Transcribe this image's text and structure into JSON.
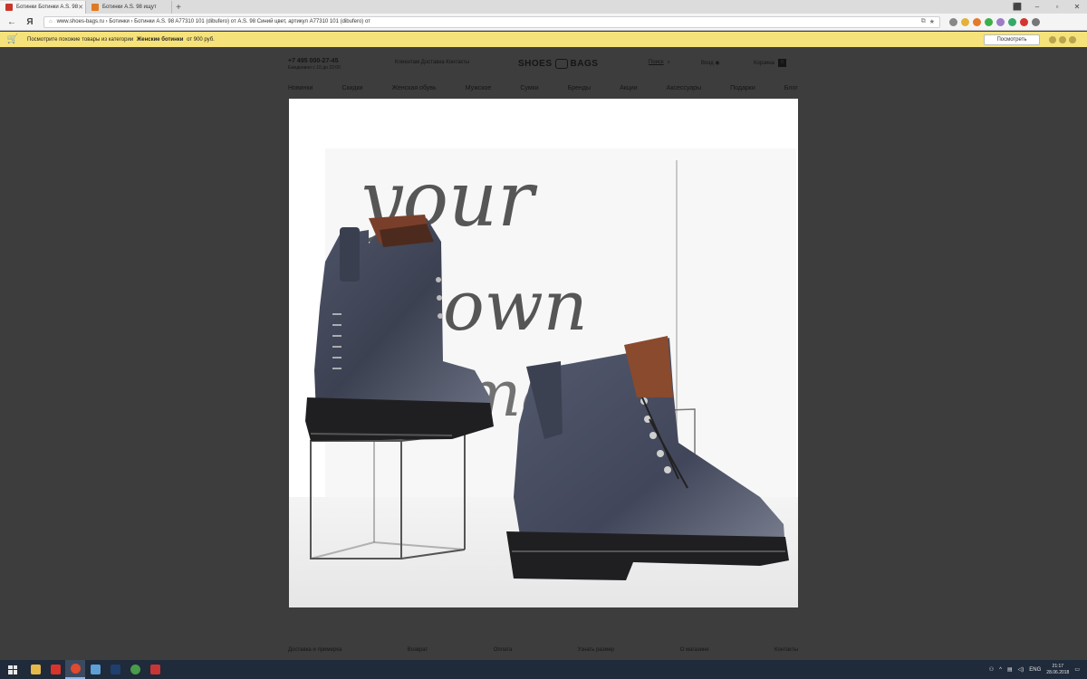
{
  "browser": {
    "tabs": [
      {
        "label": "Ботинки Ботинки A.S. 98",
        "fav_color": "#c9342b",
        "active": true
      },
      {
        "label": "Ботинки A.S. 98 ищут",
        "fav_color": "#e07a1f",
        "active": false
      }
    ],
    "new_tab": "+",
    "window_controls": {
      "minimize": "–",
      "maximize": "▫",
      "close": "✕",
      "badge": "⬛"
    },
    "url": "www.shoes-bags.ru › Ботинки › Ботинки A.S. 98 A77310 101 (dibufero) от A.S. 98 Синий цвет, артикул A77310 101 (dibufero) от"
  },
  "notification": {
    "text_prefix": "Посмотрите похожие товары из категории",
    "category": "Женские ботинки",
    "price": "от 900 руб.",
    "button": "Посмотреть"
  },
  "site": {
    "phone": "+7 495 000-27-45",
    "phone_sub": "Ежедневно с 10 до 22:00",
    "topmenu": "Клиентам  Доставка  Контакты",
    "logo_left": "SHOES",
    "logo_right": "BAGS",
    "search_label": "Поиск",
    "search_icon": "search-icon",
    "login_label": "Вход",
    "cart_label": "Корзина",
    "cart_count": "0",
    "nav": [
      "Новинки",
      "Скидки",
      "Женская обувь",
      "Мужское",
      "Сумки",
      "Бренды",
      "Акции",
      "Аксессуары",
      "Подарки",
      "Блог"
    ],
    "footer_nav": [
      "Доставка и примерка",
      "Возврат",
      "Оплата",
      "Узнать размер",
      "О магазине",
      "Контакты"
    ]
  },
  "photo": {
    "lettering": [
      "your",
      "own",
      "magic"
    ]
  },
  "taskbar": {
    "apps": [
      {
        "name": "explorer",
        "color": "#e6b84a",
        "active": false
      },
      {
        "name": "media",
        "color": "#d8342b",
        "active": false
      },
      {
        "name": "yandex-browser",
        "color": "#e04a2f",
        "active": true
      },
      {
        "name": "calculator",
        "color": "#5f9fd8",
        "active": false
      },
      {
        "name": "photoshop",
        "color": "#1f3f6f",
        "active": false
      },
      {
        "name": "chrome",
        "color": "#4a9b4a",
        "active": false
      },
      {
        "name": "yandex",
        "color": "#c73535",
        "active": false
      }
    ],
    "tray_lang": "ENG",
    "clock_time": "21:17",
    "clock_date": "28.06.2018"
  }
}
